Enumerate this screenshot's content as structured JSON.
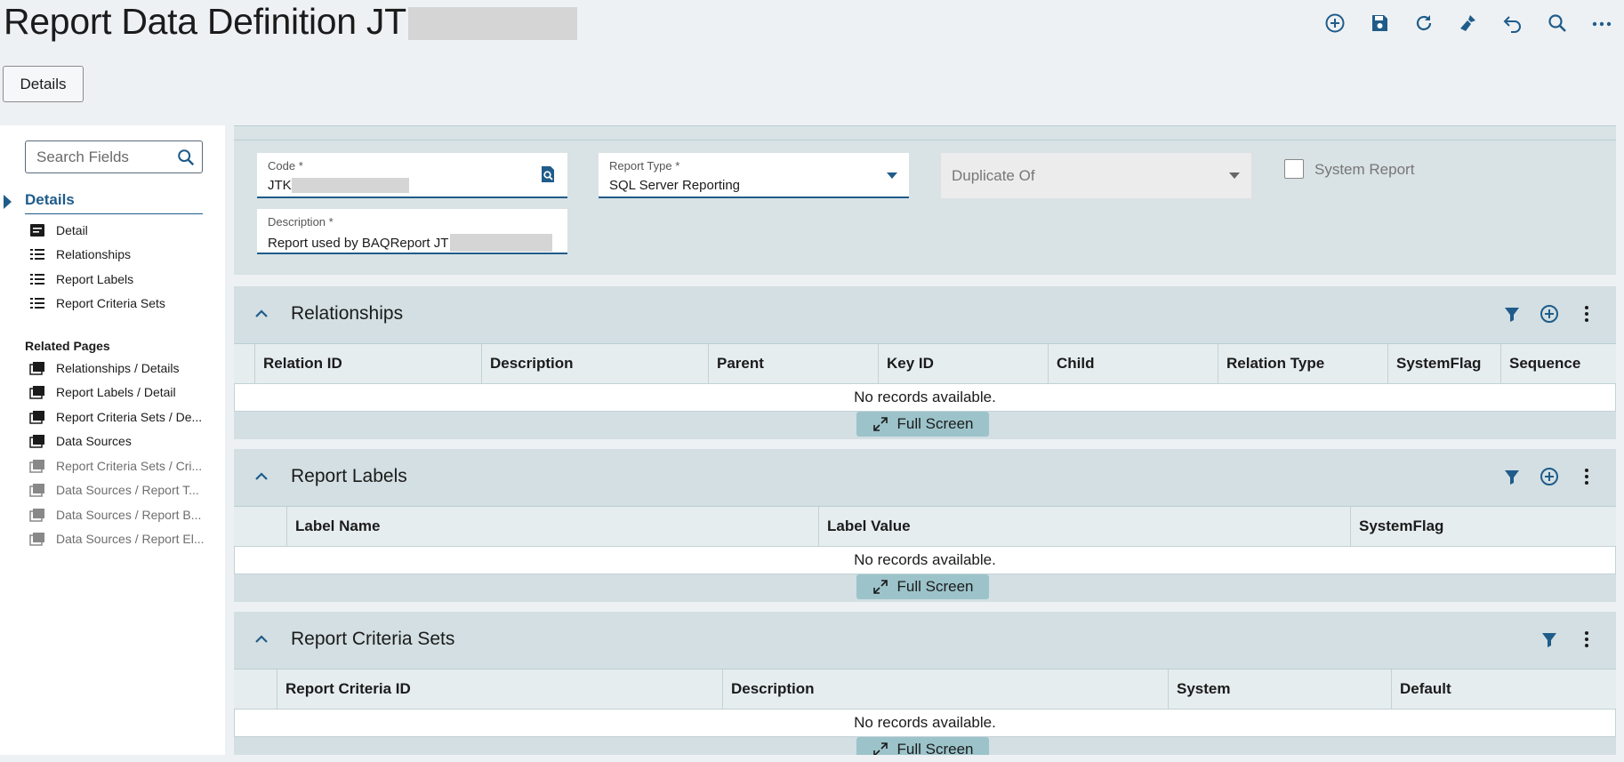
{
  "page": {
    "title": "Report Data Definition JT"
  },
  "toolbar": {
    "icons": [
      "add-icon",
      "save-icon",
      "refresh-icon",
      "clear-icon",
      "undo-icon",
      "search-icon",
      "more-icon"
    ]
  },
  "details_button": {
    "label": "Details"
  },
  "sidebar": {
    "search_placeholder": "Search Fields",
    "section": "Details",
    "items": [
      {
        "label": "Detail",
        "icon": "detail-icon"
      },
      {
        "label": "Relationships",
        "icon": "list-icon"
      },
      {
        "label": "Report Labels",
        "icon": "list-icon"
      },
      {
        "label": "Report Criteria Sets",
        "icon": "list-icon"
      }
    ],
    "related_title": "Related Pages",
    "related": [
      {
        "label": "Relationships / Details",
        "enabled": true
      },
      {
        "label": "Report Labels / Detail",
        "enabled": true
      },
      {
        "label": "Report Criteria Sets / De...",
        "enabled": true
      },
      {
        "label": "Data Sources",
        "enabled": true
      },
      {
        "label": "Report Criteria Sets / Cri...",
        "enabled": false
      },
      {
        "label": "Data Sources / Report T...",
        "enabled": false
      },
      {
        "label": "Data Sources / Report B...",
        "enabled": false
      },
      {
        "label": "Data Sources / Report El...",
        "enabled": false
      }
    ]
  },
  "form": {
    "code": {
      "label": "Code *",
      "value": "JTK"
    },
    "report_type": {
      "label": "Report Type *",
      "value": "SQL Server Reporting"
    },
    "duplicate_of": {
      "placeholder": "Duplicate Of"
    },
    "system_report": {
      "label": "System Report",
      "checked": false
    },
    "description": {
      "label": "Description *",
      "value": "Report used by BAQReport JT"
    }
  },
  "grids": {
    "relationships": {
      "title": "Relationships",
      "columns": [
        "Relation ID",
        "Description",
        "Parent",
        "Key ID",
        "Child",
        "Relation Type",
        "SystemFlag",
        "Sequence"
      ],
      "empty": "No records available.",
      "fullscreen": "Full Screen"
    },
    "labels": {
      "title": "Report Labels",
      "columns": [
        "Label Name",
        "Label Value",
        "SystemFlag"
      ],
      "empty": "No records available.",
      "fullscreen": "Full Screen"
    },
    "criteria": {
      "title": "Report Criteria Sets",
      "columns": [
        "Report Criteria ID",
        "Description",
        "System",
        "Default"
      ],
      "empty": "No records available.",
      "fullscreen": "Full Screen"
    }
  },
  "colors": {
    "accent": "#1f5c8a",
    "panel": "#d3dfe2",
    "fullscreen_btn": "#9cc3ca"
  }
}
